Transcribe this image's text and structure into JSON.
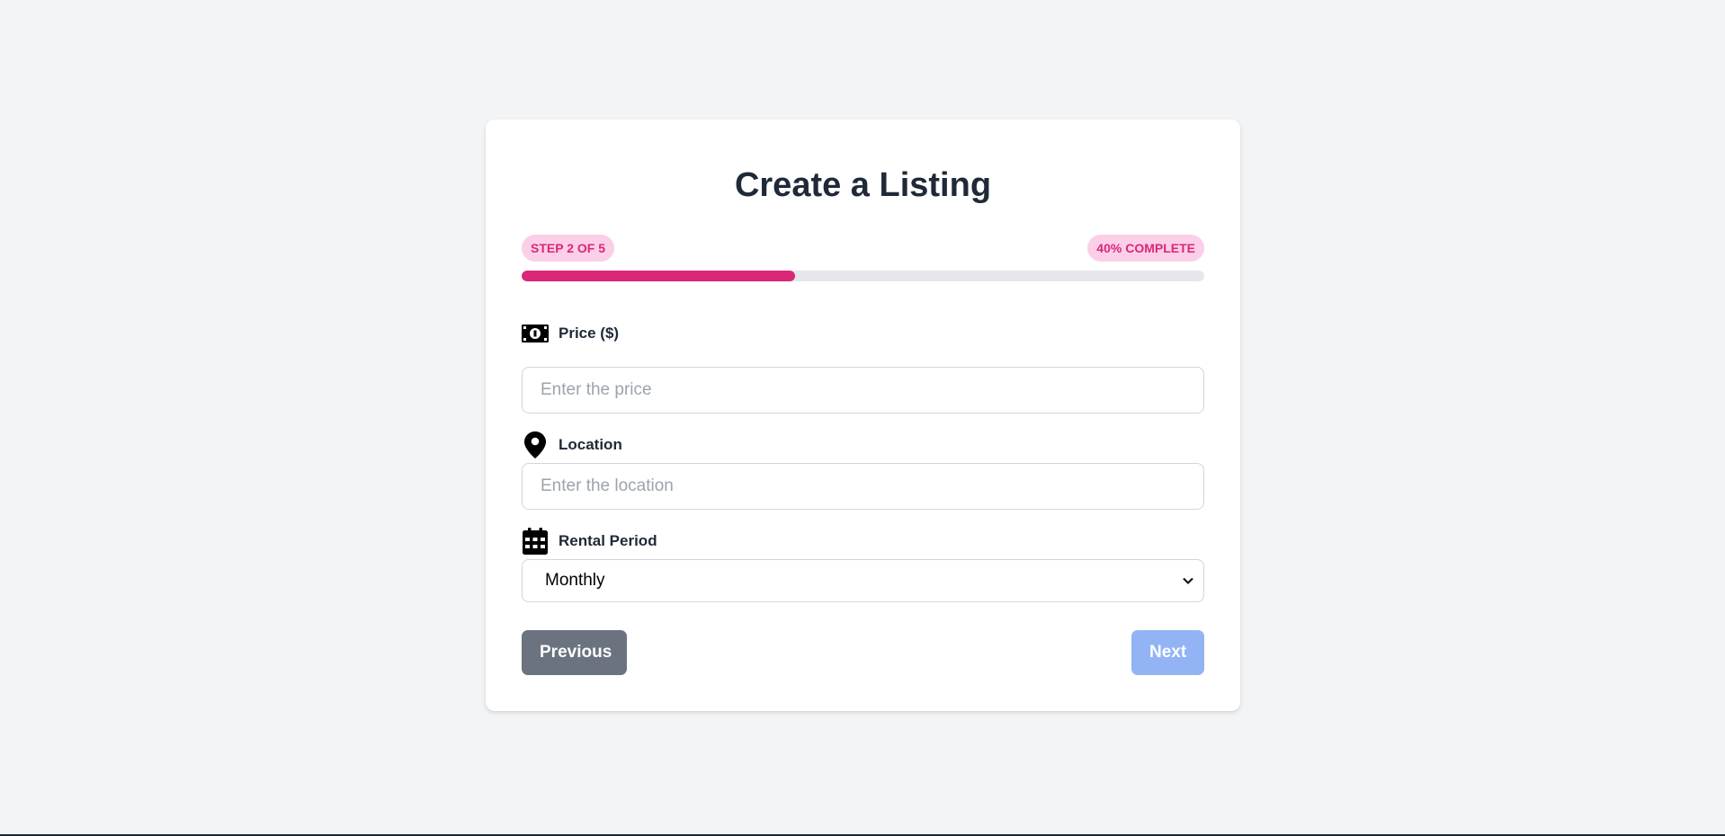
{
  "form": {
    "title": "Create a Listing",
    "step_badge": "STEP 2 OF 5",
    "complete_badge": "40% COMPLETE",
    "progress_percent": 40,
    "accent_color": "#db2777",
    "fields": {
      "price": {
        "label": "Price ($)",
        "placeholder": "Enter the price",
        "value": "",
        "icon": "money-bill-icon"
      },
      "location": {
        "label": "Location",
        "placeholder": "Enter the location",
        "value": "",
        "icon": "map-pin-icon"
      },
      "rental_period": {
        "label": "Rental Period",
        "selected": "Monthly",
        "icon": "calendar-icon"
      }
    },
    "buttons": {
      "previous": "Previous",
      "next": "Next"
    }
  }
}
